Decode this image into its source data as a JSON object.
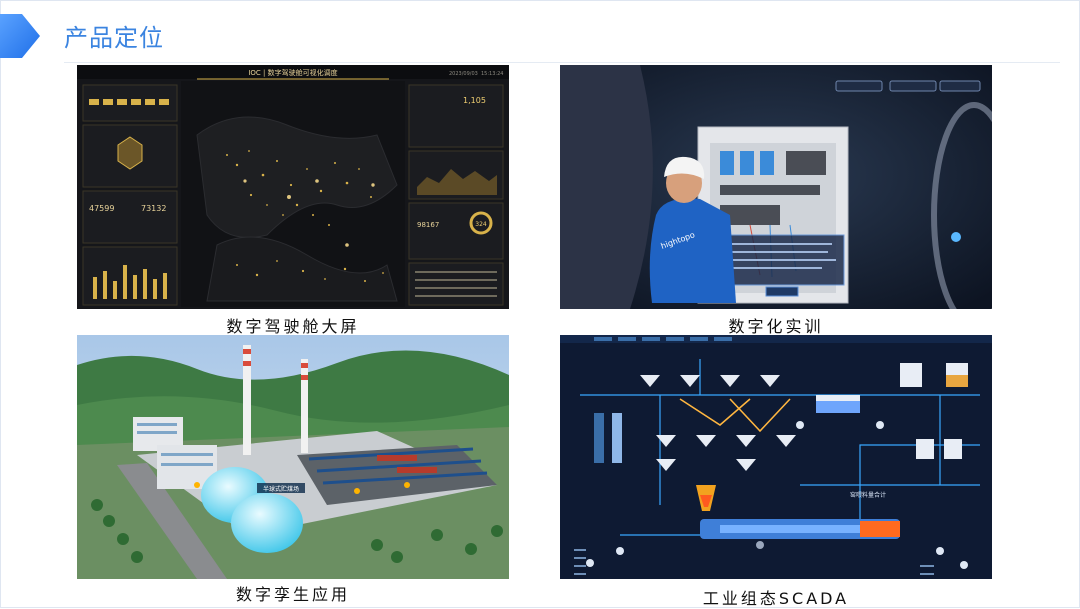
{
  "slide": {
    "title": "产品定位"
  },
  "panels": [
    {
      "caption": "数字驾驶舱大屏",
      "header": "IOC | 数字驾驶舱可视化调度",
      "date": "2023/09/03",
      "time": "15:13:24",
      "stats": [
        "47599",
        "73132",
        "1,105",
        "98167",
        "324"
      ]
    },
    {
      "caption": "数字化实训",
      "shirt_brand": "hightopo"
    },
    {
      "caption": "数字孪生应用",
      "dome_label": "半球式贮煤场"
    },
    {
      "caption": "工业组态SCADA",
      "flow_label": "窑喂料量合计"
    }
  ],
  "colors": {
    "title": "#3b84e0",
    "brand": "#2f7cf0",
    "cockpit_bg": "#15161a",
    "cockpit_gold": "#d8b24a",
    "scada_bg": "#0e1a33",
    "scada_line": "#39a8ff"
  }
}
